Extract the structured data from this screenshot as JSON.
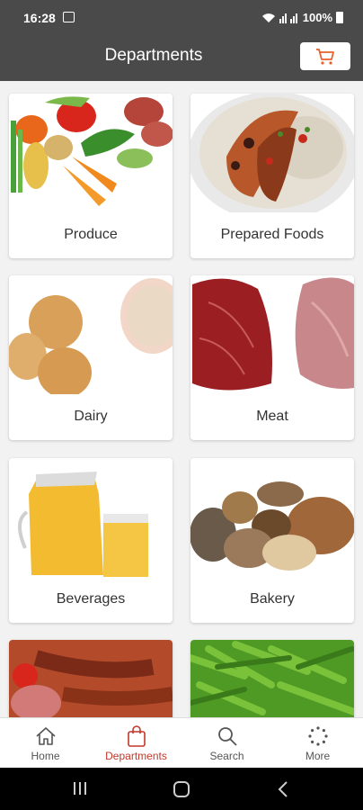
{
  "status_bar": {
    "time": "16:28",
    "battery": "100%"
  },
  "header": {
    "title": "Departments",
    "cart_icon": "cart-icon"
  },
  "departments": [
    {
      "label": "Produce"
    },
    {
      "label": "Prepared Foods"
    },
    {
      "label": "Dairy"
    },
    {
      "label": "Meat"
    },
    {
      "label": "Beverages"
    },
    {
      "label": "Bakery"
    },
    {
      "label": ""
    },
    {
      "label": ""
    }
  ],
  "bottom_nav": [
    {
      "label": "Home",
      "icon": "home-icon"
    },
    {
      "label": "Departments",
      "icon": "bag-icon"
    },
    {
      "label": "Search",
      "icon": "search-icon"
    },
    {
      "label": "More",
      "icon": "more-icon"
    }
  ],
  "colors": {
    "accent": "#e8622c",
    "active_nav": "#c0392b",
    "header": "#4a4a4a"
  }
}
